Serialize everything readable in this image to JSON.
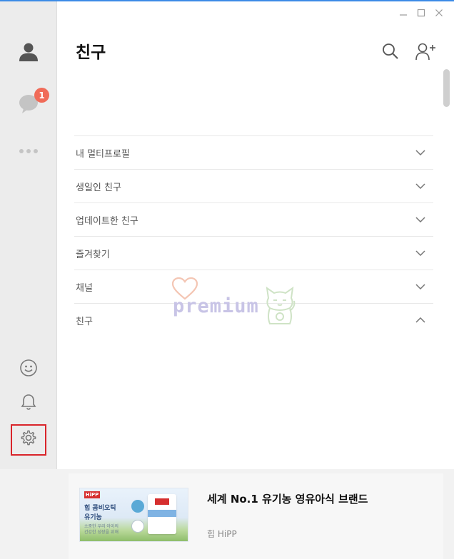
{
  "app": {
    "title": "친구"
  },
  "sidebar": {
    "items": [
      {
        "name": "friends",
        "icon": "person-icon"
      },
      {
        "name": "chats",
        "icon": "chat-bubble-icon",
        "badge": "1"
      },
      {
        "name": "more",
        "icon": "more-dots-icon"
      },
      {
        "name": "emoticon",
        "icon": "smiley-icon"
      },
      {
        "name": "notifications",
        "icon": "bell-icon"
      },
      {
        "name": "settings",
        "icon": "gear-icon"
      }
    ]
  },
  "header": {
    "icons": [
      "search-icon",
      "add-friend-icon"
    ]
  },
  "window_controls": [
    "minimize-icon",
    "maximize-icon",
    "close-icon"
  ],
  "sections": [
    {
      "label": "내 멀티프로필",
      "expanded": false
    },
    {
      "label": "생일인 친구",
      "expanded": false
    },
    {
      "label": "업데이트한 친구",
      "expanded": false
    },
    {
      "label": "즐겨찾기",
      "expanded": false
    },
    {
      "label": "채널",
      "expanded": false
    },
    {
      "label": "친구",
      "expanded": true
    }
  ],
  "watermark": {
    "text": "premium"
  },
  "ad": {
    "image": {
      "logo": "HiPP",
      "line1": "힙 콤비오틱",
      "line2": "유기농",
      "line3": "소중한 우리 아이의",
      "line4": "건강한 성장을 위해"
    },
    "title": "세계 No.1 유기농 영유아식 브랜드",
    "brand": "힙 HiPP"
  },
  "colors": {
    "accent_line": "#3c8be6",
    "badge": "#f06b58",
    "highlight_box": "#d9242a",
    "sidebar_bg": "#ececec"
  }
}
